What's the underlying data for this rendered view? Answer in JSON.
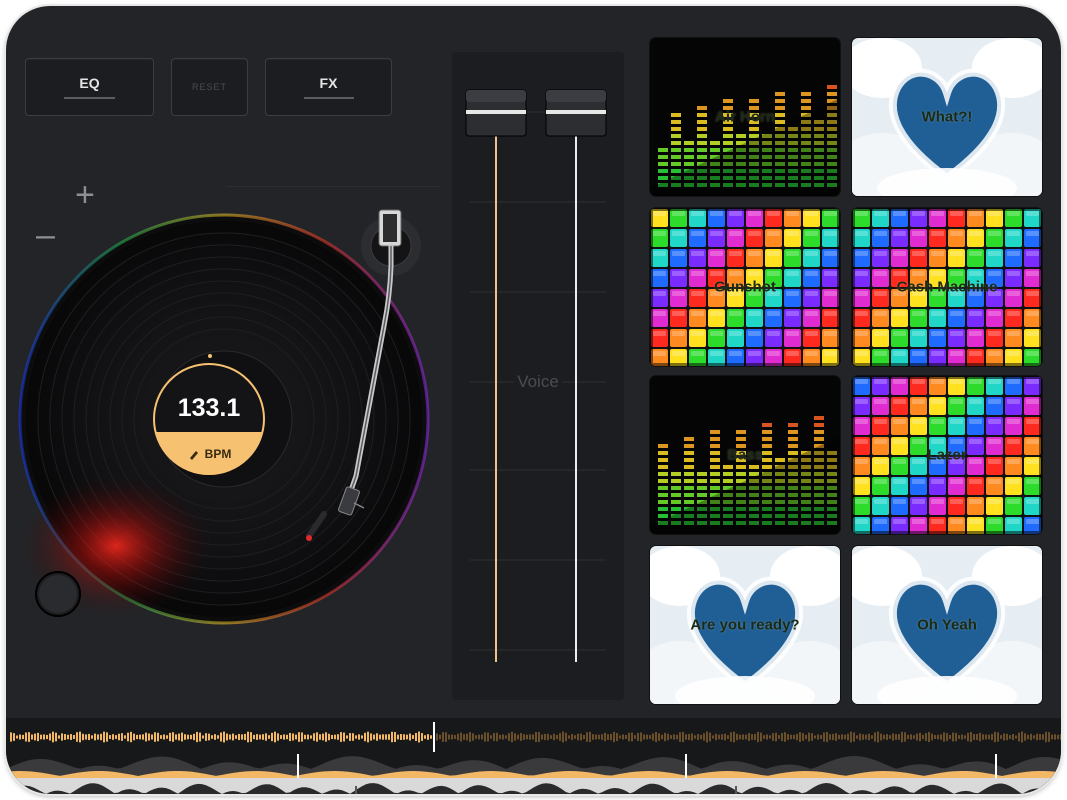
{
  "toolbar": {
    "eq_label": "EQ",
    "reset_label": "RESET",
    "fx_label": "FX"
  },
  "deck": {
    "tempo": "133.1",
    "tempo_unit": "BPM",
    "pitch_up": "+",
    "pitch_down": "–"
  },
  "mixer": {
    "voice_label": "Voice",
    "fader_left_level": 0.0,
    "fader_right_level": 0.0
  },
  "pads": [
    {
      "label": "Air Horn",
      "style": "equalizer"
    },
    {
      "label": "What?!",
      "style": "heart-clouds"
    },
    {
      "label": "Gunshot",
      "style": "rainbow-cubes"
    },
    {
      "label": "Cash Machine",
      "style": "rainbow-cubes"
    },
    {
      "label": "Bass",
      "style": "equalizer"
    },
    {
      "label": "Lazer",
      "style": "rainbow-cubes"
    },
    {
      "label": "Are you ready?",
      "style": "heart-clouds"
    },
    {
      "label": "Oh Yeah",
      "style": "heart-clouds"
    }
  ],
  "colors": {
    "accent": "#f7c172",
    "background": "#232427",
    "cue_glow": "#e0221c",
    "waveform": "#f2b866"
  }
}
